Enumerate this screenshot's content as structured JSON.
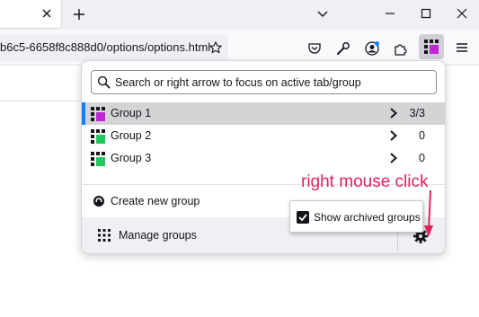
{
  "browser": {
    "url_fragment": "b6c5-6658f8c888d0/options/options.html"
  },
  "search": {
    "placeholder": "Search or right arrow to focus on active tab/group"
  },
  "groups": [
    {
      "label": "Group 1",
      "count": "3/3",
      "active": true,
      "color": "#c026d3"
    },
    {
      "label": "Group 2",
      "count": "0",
      "active": false,
      "color": "#22c55e"
    },
    {
      "label": "Group 3",
      "count": "0",
      "active": false,
      "color": "#22c55e"
    }
  ],
  "actions": {
    "create_label": "Create new group",
    "manage_label": "Manage groups"
  },
  "context_menu": {
    "item_label": "Show archived groups",
    "checked": true
  },
  "annotation": {
    "text": "right mouse click",
    "color": "#e0245e"
  },
  "colors": {
    "accent": "#0a84ff",
    "active_row": "#d4d4d6"
  },
  "icons": [
    "close-icon",
    "plus-icon",
    "chevron-down-icon",
    "minimize-icon",
    "maximize-icon",
    "window-close-icon",
    "star-icon",
    "pocket-icon",
    "wrench-icon",
    "account-icon",
    "extensions-icon",
    "tab-groups-icon",
    "hamburger-menu-icon",
    "search-icon",
    "chevron-right-icon",
    "create-group-icon",
    "grid-icon",
    "gear-icon",
    "checkbox-icon"
  ]
}
